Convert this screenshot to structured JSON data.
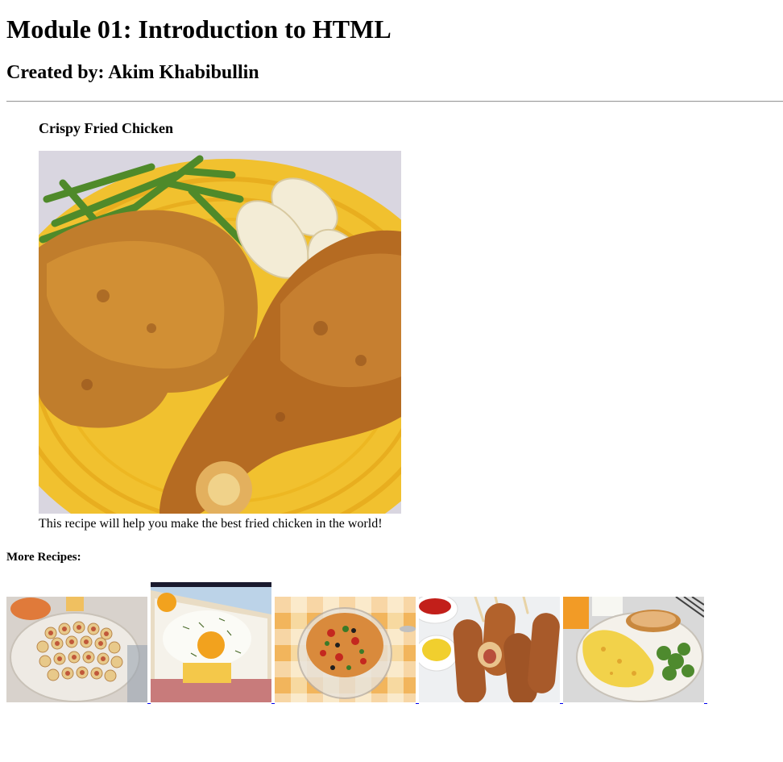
{
  "header": {
    "title": "Module 01: Introduction to HTML",
    "author_line": "Created by: Akim Khabibullin"
  },
  "featured": {
    "title": "Crispy Fried Chicken",
    "image_alt": "Crispy fried chicken with green beans and potatoes on a yellow plate",
    "caption": "This recipe will help you make the best fried chicken in the world!"
  },
  "more": {
    "title": "More Recipes:",
    "items": [
      {
        "alt": "Pigs in a blanket pinwheels on a plate"
      },
      {
        "alt": "Egg and cheese toast sandwich"
      },
      {
        "alt": "Pasta salad in a glass bowl"
      },
      {
        "alt": "Corn dogs with ketchup and mustard"
      },
      {
        "alt": "Cheese omelette with toast and greens"
      }
    ]
  },
  "colors": {
    "link": "#0000ee",
    "plate_yellow": "#f2c431",
    "chicken_brown": "#b8742a"
  }
}
